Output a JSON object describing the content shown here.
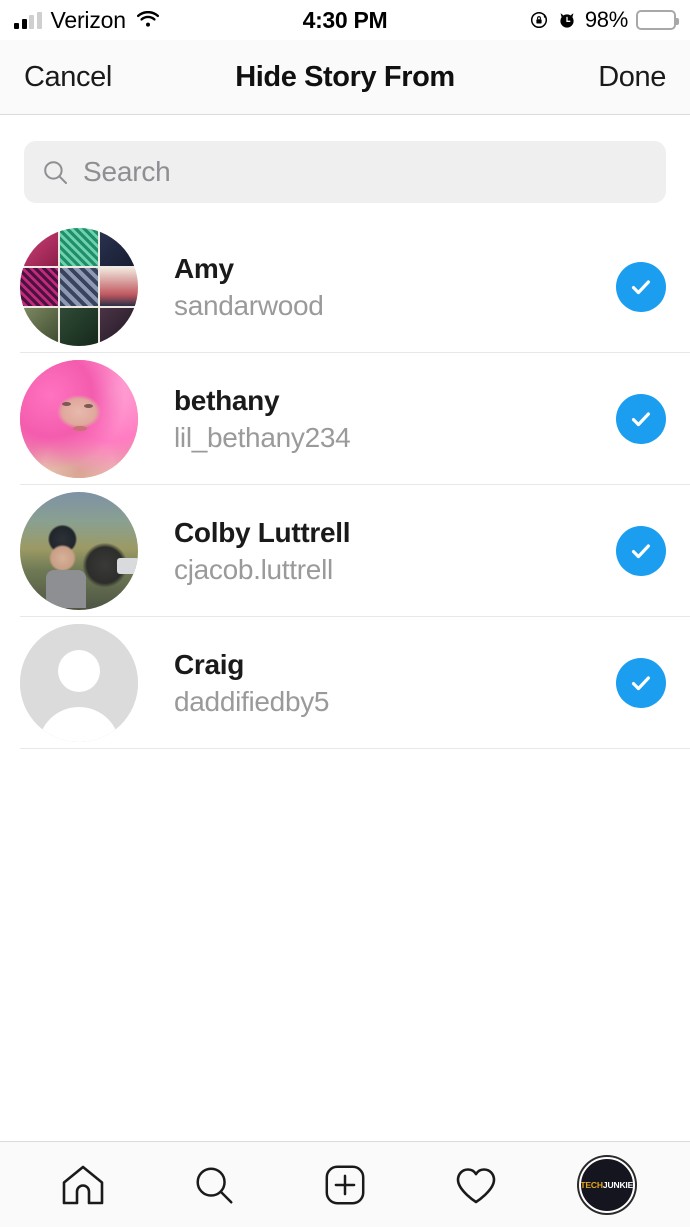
{
  "status_bar": {
    "carrier": "Verizon",
    "time": "4:30 PM",
    "battery_percent": "98%",
    "icons": {
      "signal": "signal-bars-icon",
      "wifi": "wifi-icon",
      "rotation_lock": "rotation-lock-icon",
      "alarm": "alarm-clock-icon",
      "battery": "battery-icon"
    },
    "battery_color": "#ffcc00",
    "signal_bars_filled": 2,
    "signal_bars_total": 4
  },
  "nav_bar": {
    "cancel_label": "Cancel",
    "title": "Hide Story From",
    "done_label": "Done"
  },
  "search": {
    "placeholder": "Search",
    "value": "",
    "icon": "search-icon"
  },
  "colors": {
    "accent_blue": "#1b9df0",
    "background": "#ffffff",
    "chrome": "#fafafa",
    "separator": "#e8e8e8",
    "search_field": "#efefef",
    "secondary_text": "#9a9a9a"
  },
  "user_list": [
    {
      "full_name": "Amy",
      "username": "sandarwood",
      "selected": true,
      "avatar_type": "collage",
      "avatar_description": "grid collage of colorful fabric products",
      "collage_tiles": [
        "#c1356a",
        "#2f9e76",
        "#2b3555",
        "#43163b",
        "#3a4a63",
        "#d8b8b0",
        "#6f7f5e",
        "#2e4234",
        "#3d2f3c"
      ]
    },
    {
      "full_name": "bethany",
      "username": "lil_bethany234",
      "selected": true,
      "avatar_type": "portrait-pink",
      "avatar_description": "selfie portrait with pink hair"
    },
    {
      "full_name": "Colby Luttrell",
      "username": "cjacob.luttrell",
      "selected": true,
      "avatar_type": "photo-outdoor",
      "avatar_description": "person in cap outdoors"
    },
    {
      "full_name": "Craig",
      "username": "daddifiedby5",
      "selected": true,
      "avatar_type": "placeholder",
      "avatar_description": "default gray person placeholder"
    }
  ],
  "tab_bar": {
    "items": [
      {
        "name": "home-tab",
        "icon": "home-icon"
      },
      {
        "name": "search-tab",
        "icon": "search-icon"
      },
      {
        "name": "add-post-tab",
        "icon": "plus-square-icon"
      },
      {
        "name": "activity-tab",
        "icon": "heart-icon"
      },
      {
        "name": "profile-tab",
        "icon": "profile-avatar-icon"
      }
    ],
    "profile_avatar_text_a": "TECH",
    "profile_avatar_text_b": "JUNKIE"
  }
}
